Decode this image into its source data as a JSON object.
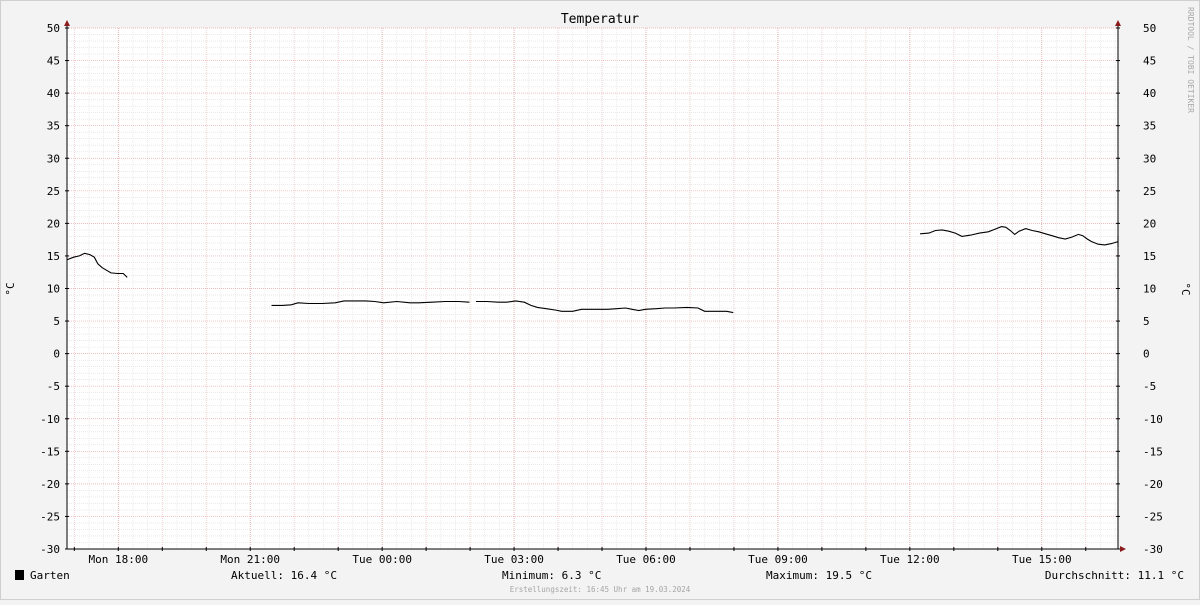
{
  "chart_data": {
    "type": "line",
    "title": "Temperatur",
    "ylabel": "°C",
    "ylabel_right": "°C",
    "ylim": [
      -30,
      50
    ],
    "yticks": [
      50,
      45,
      40,
      35,
      30,
      25,
      20,
      15,
      10,
      5,
      0,
      -5,
      -10,
      -15,
      -20,
      -25,
      -30
    ],
    "x_unit": "hours since Mon 16:50",
    "xlim": [
      0,
      23.9
    ],
    "xticks": [
      {
        "label": "Mon 18:00",
        "x": 1.1667
      },
      {
        "label": "Mon 21:00",
        "x": 4.1667
      },
      {
        "label": "Tue 00:00",
        "x": 7.1667
      },
      {
        "label": "Tue 03:00",
        "x": 10.1667
      },
      {
        "label": "Tue 06:00",
        "x": 13.1667
      },
      {
        "label": "Tue 09:00",
        "x": 16.1667
      },
      {
        "label": "Tue 12:00",
        "x": 19.1667
      },
      {
        "label": "Tue 15:00",
        "x": 22.1667
      }
    ],
    "grid": true,
    "series": [
      {
        "name": "Garten",
        "color": "#000000",
        "segments": [
          [
            [
              0.0,
              14.4
            ],
            [
              0.15,
              14.8
            ],
            [
              0.28,
              15.0
            ],
            [
              0.4,
              15.4
            ],
            [
              0.52,
              15.2
            ],
            [
              0.62,
              14.8
            ],
            [
              0.7,
              13.8
            ],
            [
              0.8,
              13.2
            ],
            [
              0.9,
              12.8
            ],
            [
              1.0,
              12.4
            ],
            [
              1.15,
              12.3
            ],
            [
              1.28,
              12.3
            ],
            [
              1.37,
              11.7
            ]
          ],
          [
            [
              4.65,
              7.4
            ],
            [
              4.9,
              7.4
            ],
            [
              5.1,
              7.5
            ],
            [
              5.25,
              7.8
            ],
            [
              5.5,
              7.7
            ],
            [
              5.8,
              7.7
            ],
            [
              6.1,
              7.8
            ],
            [
              6.3,
              8.1
            ],
            [
              6.55,
              8.1
            ],
            [
              6.8,
              8.1
            ],
            [
              7.0,
              8.0
            ],
            [
              7.2,
              7.8
            ],
            [
              7.5,
              8.0
            ],
            [
              7.8,
              7.8
            ],
            [
              8.0,
              7.8
            ],
            [
              8.3,
              7.9
            ],
            [
              8.6,
              8.0
            ],
            [
              8.9,
              8.0
            ],
            [
              9.15,
              7.9
            ]
          ],
          [
            [
              9.3,
              8.0
            ],
            [
              9.55,
              8.0
            ],
            [
              9.8,
              7.9
            ],
            [
              10.0,
              7.9
            ],
            [
              10.2,
              8.1
            ],
            [
              10.4,
              7.9
            ],
            [
              10.55,
              7.4
            ],
            [
              10.7,
              7.1
            ],
            [
              10.9,
              6.9
            ],
            [
              11.1,
              6.7
            ],
            [
              11.25,
              6.5
            ],
            [
              11.5,
              6.5
            ],
            [
              11.7,
              6.8
            ],
            [
              11.9,
              6.8
            ],
            [
              12.1,
              6.8
            ],
            [
              12.3,
              6.8
            ],
            [
              12.5,
              6.9
            ],
            [
              12.7,
              7.0
            ],
            [
              12.85,
              6.8
            ],
            [
              13.0,
              6.6
            ],
            [
              13.15,
              6.8
            ],
            [
              13.4,
              6.9
            ],
            [
              13.6,
              7.0
            ],
            [
              13.8,
              7.0
            ],
            [
              14.1,
              7.1
            ],
            [
              14.35,
              7.0
            ],
            [
              14.5,
              6.5
            ],
            [
              14.8,
              6.5
            ],
            [
              15.0,
              6.5
            ],
            [
              15.15,
              6.3
            ]
          ],
          [
            [
              19.4,
              18.4
            ],
            [
              19.6,
              18.5
            ],
            [
              19.75,
              18.9
            ],
            [
              19.9,
              19.0
            ],
            [
              20.05,
              18.8
            ],
            [
              20.2,
              18.5
            ],
            [
              20.35,
              18.0
            ],
            [
              20.55,
              18.2
            ],
            [
              20.75,
              18.5
            ],
            [
              20.95,
              18.7
            ],
            [
              21.1,
              19.1
            ],
            [
              21.25,
              19.5
            ],
            [
              21.35,
              19.4
            ],
            [
              21.45,
              18.9
            ],
            [
              21.55,
              18.3
            ],
            [
              21.65,
              18.8
            ],
            [
              21.8,
              19.2
            ],
            [
              21.95,
              18.9
            ],
            [
              22.1,
              18.7
            ],
            [
              22.25,
              18.4
            ],
            [
              22.4,
              18.1
            ],
            [
              22.55,
              17.8
            ],
            [
              22.7,
              17.6
            ],
            [
              22.85,
              17.9
            ],
            [
              23.0,
              18.3
            ],
            [
              23.1,
              18.1
            ],
            [
              23.2,
              17.6
            ],
            [
              23.3,
              17.2
            ],
            [
              23.45,
              16.8
            ],
            [
              23.6,
              16.7
            ],
            [
              23.75,
              16.9
            ],
            [
              23.9,
              17.2
            ],
            [
              24.05,
              17.4
            ],
            [
              24.15,
              17.8
            ],
            [
              24.25,
              18.1
            ],
            [
              24.35,
              17.9
            ],
            [
              24.45,
              17.2
            ],
            [
              24.55,
              16.9
            ],
            [
              24.65,
              16.6
            ],
            [
              24.7,
              16.4
            ]
          ]
        ]
      }
    ]
  },
  "legend": {
    "series_name": "Garten",
    "aktuell": "Aktuell: 16.4 °C",
    "minimum": "Minimum: 6.3 °C",
    "maximum": "Maximum: 19.5 °C",
    "durchschnitt": "Durchschnitt: 11.1 °C"
  },
  "footer": {
    "created": "Erstellungszeit: 16:45 Uhr am 19.03.2024"
  },
  "watermark": "RRDTOOL / TOBI OETIKER"
}
